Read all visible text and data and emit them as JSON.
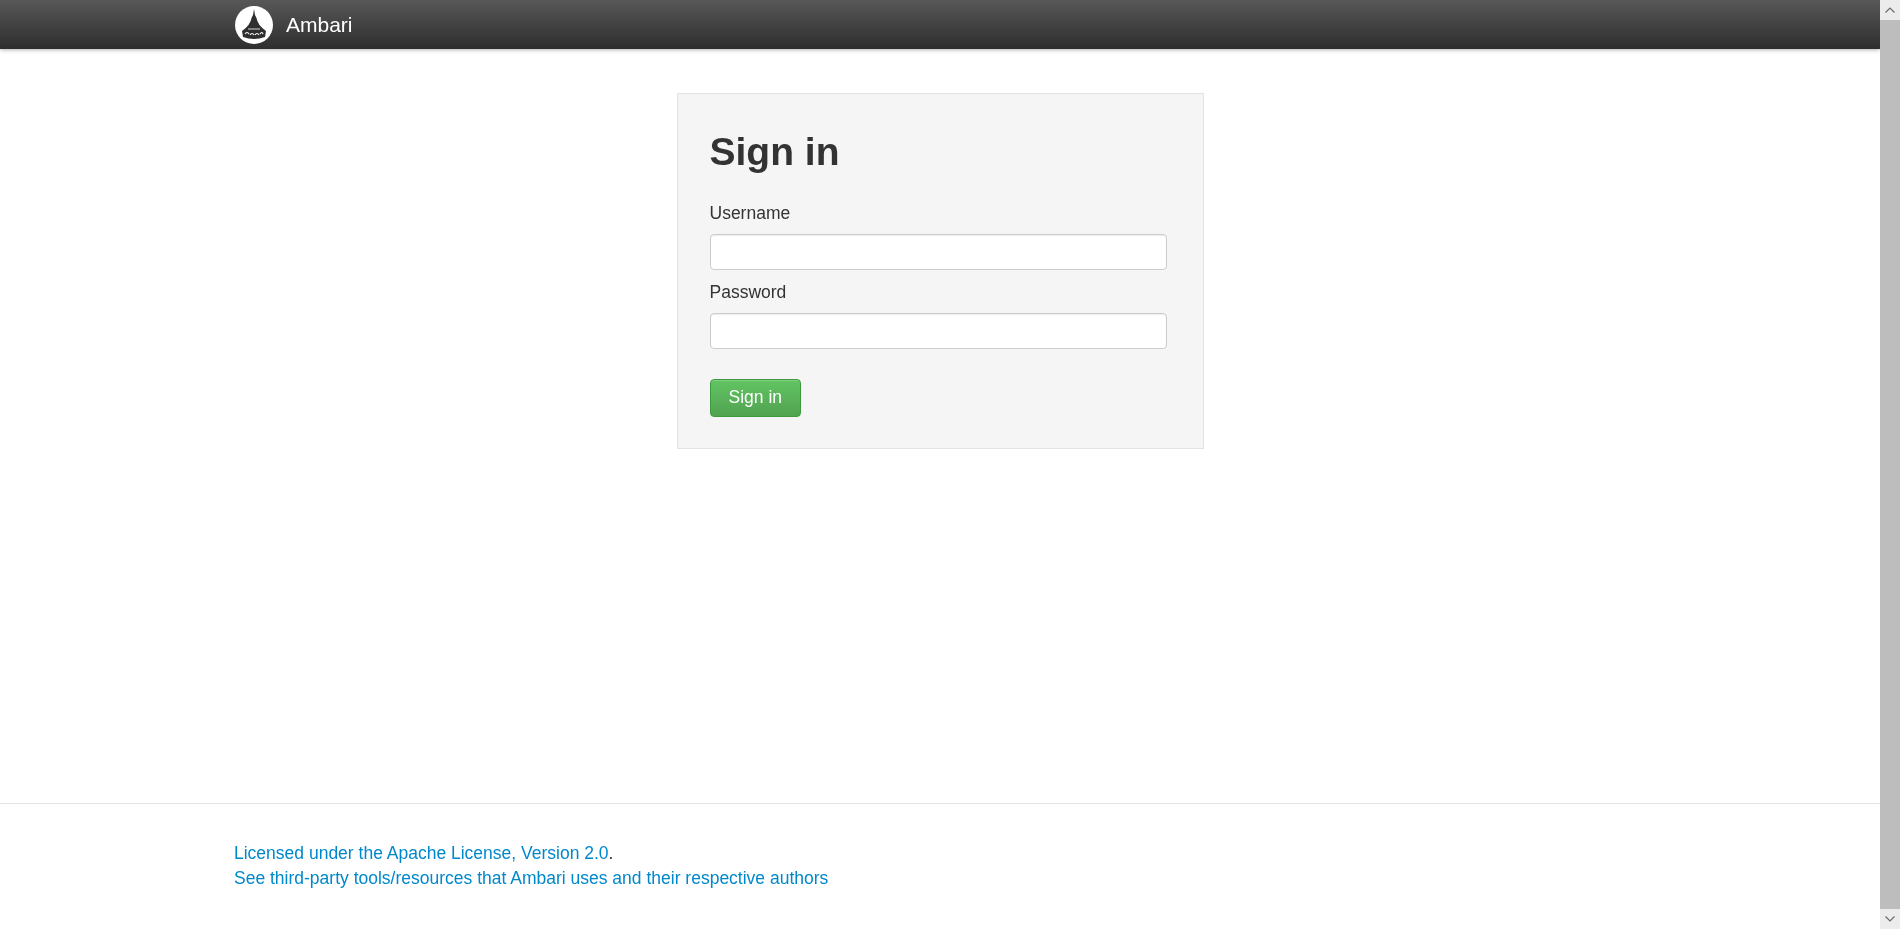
{
  "header": {
    "brand": "Ambari"
  },
  "login": {
    "title": "Sign in",
    "fields": [
      {
        "label": "Username"
      },
      {
        "label": "Password"
      }
    ],
    "submit": "Sign in"
  },
  "footer": {
    "lines": [
      {
        "link": "Licensed under the Apache License, Version 2.0",
        "after": "."
      },
      {
        "link": "See third-party tools/resources that Ambari uses and their respective authors"
      }
    ]
  }
}
